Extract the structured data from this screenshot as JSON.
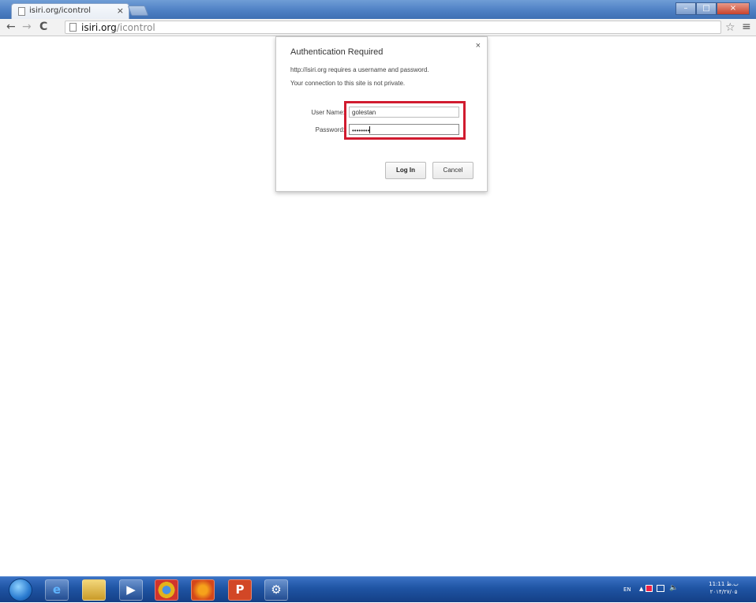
{
  "browser": {
    "tab_title": "isiri.org/icontrol",
    "tab_close": "×",
    "url_host": "isiri.org",
    "url_path": "/icontrol",
    "window_buttons": [
      "–",
      "□",
      "×"
    ],
    "nav": {
      "back": "←",
      "forward": "→",
      "reload": "C"
    },
    "star": "☆",
    "menu": "≡"
  },
  "dialog": {
    "title": "Authentication Required",
    "close": "×",
    "message_1": "http://isiri.org requires a username and password.",
    "message_2": "Your connection to this site is not private.",
    "username_label": "User Name:",
    "username_value": "golestan",
    "password_label": "Password:",
    "password_value": "••••••••",
    "login_button": "Log In",
    "cancel_button": "Cancel"
  },
  "taskbar": {
    "icons": [
      "ie-icon",
      "explorer-icon",
      "media-player-icon",
      "chrome-icon",
      "firefox-icon",
      "powerpoint-icon",
      "misc-app-icon"
    ],
    "tray": {
      "language": "EN",
      "clock_time": "11:11 ب.ظ",
      "clock_date": "۲۰۱۴/۲۷/۰۵"
    }
  },
  "colors": {
    "highlight": "#d11b2f",
    "titlebar": "#4e80c4",
    "taskbar": "#1f54a3"
  }
}
